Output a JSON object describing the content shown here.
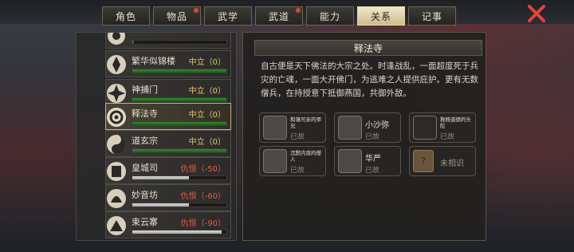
{
  "tabs": [
    {
      "label": "角色",
      "badge": false,
      "active": false
    },
    {
      "label": "物品",
      "badge": true,
      "active": false
    },
    {
      "label": "武学",
      "badge": false,
      "active": false
    },
    {
      "label": "武道",
      "badge": true,
      "active": false
    },
    {
      "label": "能力",
      "badge": false,
      "active": false
    },
    {
      "label": "关系",
      "badge": false,
      "active": true
    },
    {
      "label": "记事",
      "badge": false,
      "active": false
    }
  ],
  "factions": [
    {
      "name": "",
      "status": "",
      "bar": 0.02,
      "bar_color": "green"
    },
    {
      "name": "繁华似锦楼",
      "status": "中立（0）",
      "bar": 1.0,
      "bar_color": "green"
    },
    {
      "name": "神捕门",
      "status": "中立（0）",
      "bar": 1.0,
      "bar_color": "green"
    },
    {
      "name": "释法寺",
      "status": "中立（0）",
      "bar": 1.0,
      "bar_color": "green",
      "selected": true
    },
    {
      "name": "道玄宗",
      "status": "中立（0）",
      "bar": 1.0,
      "bar_color": "green"
    },
    {
      "name": "皇城司",
      "status": "仇恨（-50）",
      "bar": 0.6,
      "bar_color": "gray",
      "hostile": true
    },
    {
      "name": "妙音坊",
      "status": "仇恨（-60）",
      "bar": 0.6,
      "bar_color": "gray",
      "hostile": true
    },
    {
      "name": "束云寨",
      "status": "仇恨（-90）",
      "bar": 0.95,
      "bar_color": "gray",
      "hostile": true
    }
  ],
  "detail": {
    "title": "释法寺",
    "description": "自古便是天下佛法的大宗之处。时逢战乱，一面超度死于兵灾的亡魂，一面大开佛门，为逃难之人提供庇护。更有无数僧兵，在持授意下抵御燕国，共御外敌。",
    "members": [
      {
        "name": "和蔼可亲的师兄",
        "state": "已故",
        "small": true
      },
      {
        "name": "小沙弥",
        "state": "已故",
        "small": false
      },
      {
        "name": "救赎道德的头陀",
        "state": "已故",
        "small": true
      },
      {
        "name": "沉默内敛的僧人",
        "state": "已故",
        "small": true
      },
      {
        "name": "华严",
        "state": "已故",
        "small": false
      },
      {
        "name": "未相识",
        "state": "",
        "small": false,
        "unknown": true
      }
    ]
  },
  "colors": {
    "neutral": "#e3c66a",
    "hostile": "#e05a4a",
    "accent": "#d2b069",
    "close": "#e0453a"
  }
}
